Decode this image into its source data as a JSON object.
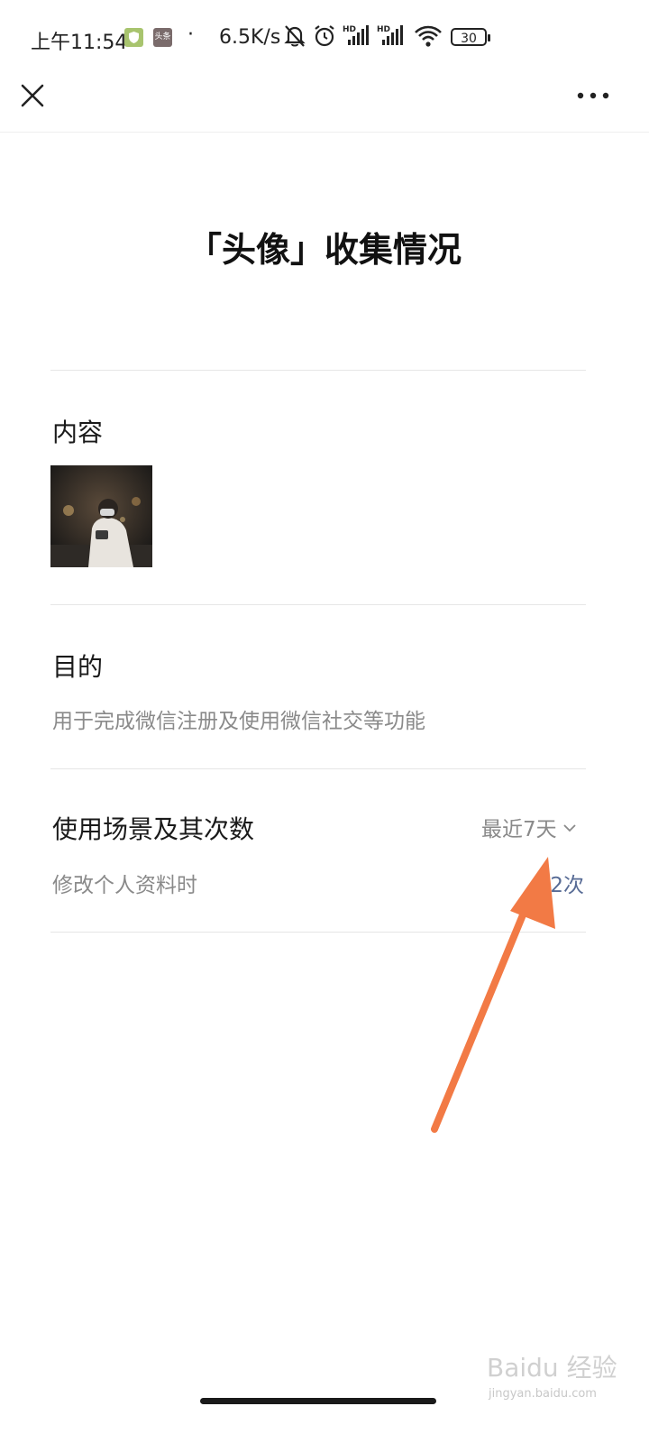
{
  "status_bar": {
    "time": "上午11:54",
    "dot": "·",
    "speed": "6.5K/s",
    "battery": "30",
    "app_icon_b_label": "头条"
  },
  "nav": {
    "close_icon": "close-icon",
    "more_icon": "more-icon"
  },
  "page": {
    "title": "「头像」收集情况"
  },
  "content_section": {
    "label": "内容"
  },
  "purpose_section": {
    "label": "目的",
    "description": "用于完成微信注册及使用微信社交等功能"
  },
  "usage_section": {
    "label": "使用场景及其次数",
    "range_label": "最近7天",
    "scene": "修改个人资料时",
    "count": "2次"
  },
  "watermark": {
    "text": "Baidu 经验",
    "sub": "jingyan.baidu.com"
  },
  "colors": {
    "accent_link": "#576b95",
    "annotation_arrow": "#f27a45",
    "secondary_text": "#8a8a8a"
  }
}
